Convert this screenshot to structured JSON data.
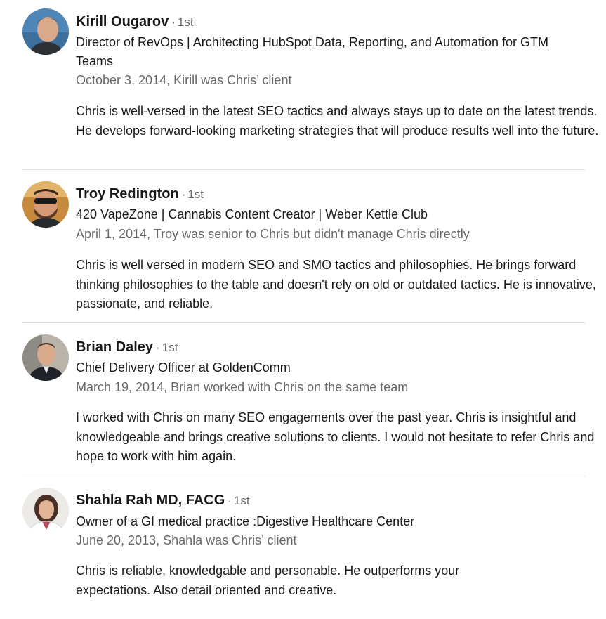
{
  "recommendations": [
    {
      "name": "Kirill Ougarov",
      "degree": "1st",
      "headline": "Director of RevOps | Architecting HubSpot Data, Reporting, and Automation for GTM Teams",
      "meta": "October 3, 2014, Kirill was Chris’ client",
      "text": "Chris is well-versed in the latest SEO tactics and always stays up to date on the latest trends. He develops forward-looking marketing strategies that will produce results well into the future."
    },
    {
      "name": "Troy Redington",
      "degree": "1st",
      "headline": "420 VapeZone | Cannabis Content Creator | Weber Kettle Club",
      "meta": "April 1, 2014, Troy was senior to Chris but didn't manage Chris directly",
      "text": "Chris is well versed in modern SEO and SMO tactics and philosophies. He brings forward thinking philosophies to the table and doesn't rely on old or outdated tactics. He is innovative, passionate, and reliable."
    },
    {
      "name": "Brian Daley",
      "degree": "1st",
      "headline": "Chief Delivery Officer at GoldenComm",
      "meta": "March 19, 2014, Brian worked with Chris on the same team",
      "text": "I worked with Chris on many SEO engagements over the past year. Chris is insightful and knowledgeable and brings creative solutions to clients. I would not hesitate to refer Chris and hope to work with him again."
    },
    {
      "name": "Shahla Rah MD, FACG",
      "degree": "1st",
      "headline": "Owner of a GI medical practice :Digestive Healthcare Center",
      "meta": "June 20, 2013, Shahla was Chris’ client",
      "text": "Chris is reliable, knowledgable and personable. He outperforms your expectations. Also detail oriented and creative."
    }
  ]
}
